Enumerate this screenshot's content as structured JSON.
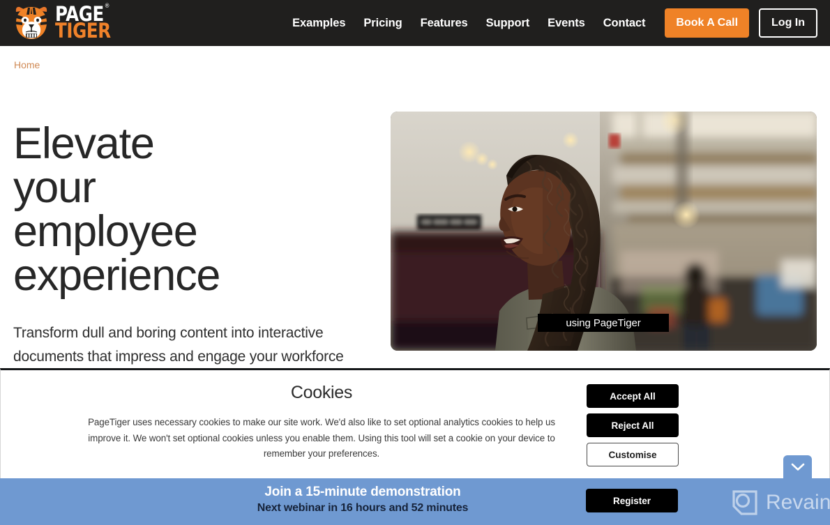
{
  "header": {
    "logo": {
      "icon": "tiger-face-icon",
      "line1": "PAGE",
      "registered": "®",
      "line2": "TIGER"
    },
    "nav": [
      {
        "label": "Examples"
      },
      {
        "label": "Pricing"
      },
      {
        "label": "Features"
      },
      {
        "label": "Support"
      },
      {
        "label": "Events"
      },
      {
        "label": "Contact"
      }
    ],
    "cta_primary": "Book A Call",
    "cta_secondary": "Log In",
    "background_color": "#201f1e",
    "accent_color": "#ef8227"
  },
  "breadcrumb": {
    "items": [
      "Home"
    ]
  },
  "hero": {
    "heading": "Elevate your employee experience",
    "subheading": "Transform dull and boring content into interactive documents that impress and engage your workforce and new hires.",
    "media": {
      "type": "video-still",
      "alt": "Woman with curly hair smiling in a modern office space",
      "caption": "using PageTiger"
    }
  },
  "cookie_banner": {
    "title": "Cookies",
    "body": "PageTiger uses necessary cookies to make our site work. We'd also like to set optional analytics cookies to help us improve it. We won't set optional cookies unless you enable them. Using this tool will set a cookie on your device to remember your preferences.",
    "buttons": [
      {
        "label": "Accept All",
        "style": "dark"
      },
      {
        "label": "Reject All",
        "style": "dark"
      },
      {
        "label": "Customise",
        "style": "light"
      }
    ],
    "collapse_icon": "chevron-down-icon"
  },
  "webinar_bar": {
    "title": "Join a 15-minute demonstration",
    "subtitle": "Next webinar in 16 hours and 52 minutes",
    "register_label": "Register",
    "background_color": "#6f99d1",
    "watermark": {
      "icon": "revain-logo-icon",
      "label": "Revain"
    }
  }
}
